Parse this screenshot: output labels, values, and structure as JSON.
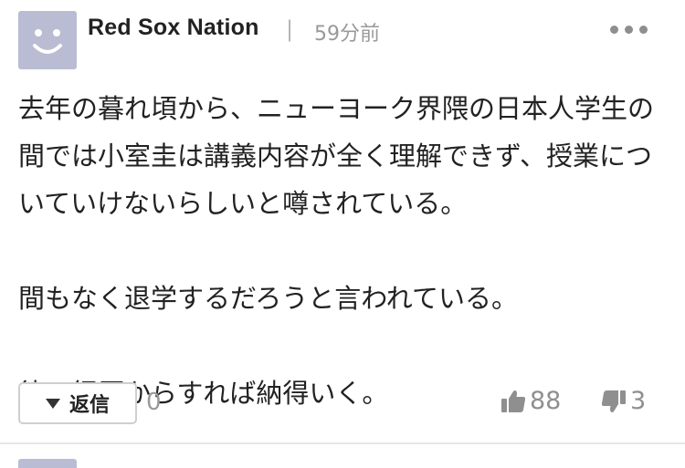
{
  "comment": {
    "author": "Red Sox Nation",
    "separator": "|",
    "time": "59分前",
    "paragraphs": [
      "去年の暮れ頃から、ニューヨーク界隈の日本人学生の間では小室圭は講義内容が全く理解できず、授業についていけないらしいと噂されている。",
      "間もなく退学するだろうと言われている。",
      "彼の経歴からすれば納得いく。"
    ],
    "reply_label": "返信",
    "reply_count": "0",
    "likes": "88",
    "dislikes": "3"
  },
  "icons": {
    "avatar": "smiley-avatar-icon",
    "more": "more-dots-icon",
    "reply": "triangle-down-icon",
    "like": "thumbs-up-icon",
    "dislike": "thumbs-down-icon"
  },
  "colors": {
    "avatar_bg": "#b9bcd3",
    "text": "#222222",
    "muted": "#999999"
  }
}
